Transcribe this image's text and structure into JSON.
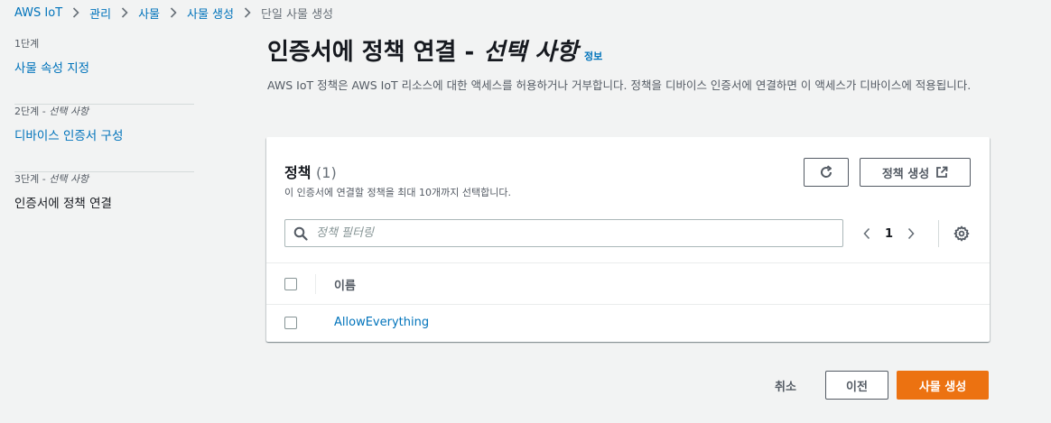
{
  "colors": {
    "accent": "#ec7211",
    "link": "#0073bb",
    "text": "#16191f",
    "muted": "#545b64",
    "background": "#f2f3f3"
  },
  "breadcrumb": {
    "items": [
      "AWS IoT",
      "관리",
      "사물",
      "사물 생성"
    ],
    "current": "단일 사물 생성",
    "separator_icon": "chevron-right-icon"
  },
  "steps": [
    {
      "kicker": "1단계",
      "optional": "",
      "title": "사물 속성 지정",
      "state": "link"
    },
    {
      "kicker": "2단계 - ",
      "optional": "선택 사항",
      "title": "디바이스 인증서 구성",
      "state": "link"
    },
    {
      "kicker": "3단계 - ",
      "optional": "선택 사항",
      "title": "인증서에 정책 연결",
      "state": "current"
    }
  ],
  "header": {
    "title": "인증서에 정책 연결 -",
    "optional": "선택 사항",
    "info_link": "정보",
    "description": "AWS IoT 정책은 AWS IoT 리소스에 대한 액세스를 허용하거나 거부합니다. 정책을 디바이스 인증서에 연결하면 이 액세스가 디바이스에 적용됩니다."
  },
  "policies": {
    "title": "정책",
    "count": "(1)",
    "description": "이 인증서에 연결할 정책을 최대 10개까지 선택합니다.",
    "refresh_icon": "refresh-icon",
    "create_button": "정책 생성",
    "external_icon": "external-link-icon",
    "filter": {
      "placeholder": "정책 필터링",
      "value": ""
    },
    "pagination": {
      "page": "1"
    },
    "settings_icon": "gear-icon",
    "columns": [
      "이름"
    ],
    "rows": [
      {
        "name": "AllowEverything",
        "selected": false
      }
    ]
  },
  "footer": {
    "cancel": "취소",
    "previous": "이전",
    "primary": "사물 생성"
  }
}
